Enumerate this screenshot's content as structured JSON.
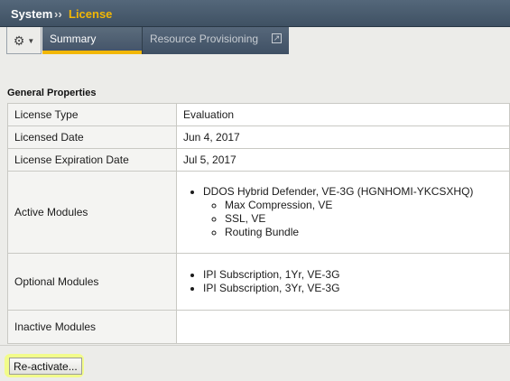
{
  "breadcrumb": {
    "system": "System",
    "separator": "››",
    "license": "License"
  },
  "tabs": {
    "gear_icon": "gear-icon",
    "summary": "Summary",
    "resource": "Resource Provisioning"
  },
  "section": {
    "title": "General Properties"
  },
  "properties": {
    "license_type_label": "License Type",
    "license_type_value": "Evaluation",
    "licensed_date_label": "Licensed Date",
    "licensed_date_value": "Jun 4, 2017",
    "expiration_label": "License Expiration Date",
    "expiration_value": "Jul 5, 2017",
    "active_label": "Active Modules",
    "active_main": "DDOS Hybrid Defender, VE-3G (HGNHOMI-YKCSXHQ)",
    "active_sub": [
      "Max Compression, VE",
      "SSL, VE",
      "Routing Bundle"
    ],
    "optional_label": "Optional Modules",
    "optional_items": [
      "IPI Subscription, 1Yr, VE-3G",
      "IPI Subscription, 3Yr, VE-3G"
    ],
    "inactive_label": "Inactive Modules"
  },
  "actions": {
    "reactivate": "Re-activate..."
  },
  "colors": {
    "accent": "#f2b705",
    "highlight": "#f3ff7a"
  }
}
